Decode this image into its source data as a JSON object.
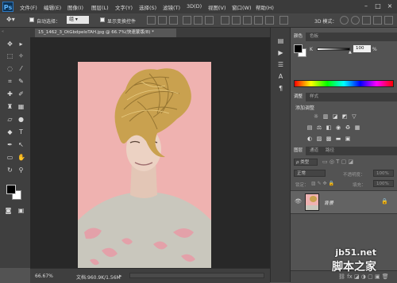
{
  "app": {
    "logo": "Ps"
  },
  "menu": [
    "文件(F)",
    "编辑(E)",
    "图像(I)",
    "图层(L)",
    "文字(Y)",
    "选择(S)",
    "滤镜(T)",
    "3D(D)",
    "视图(V)",
    "窗口(W)",
    "帮助(H)"
  ],
  "window_controls": {
    "minimize": "–",
    "maximize": "□",
    "close": "×"
  },
  "options_bar": {
    "auto_select_label": "自动选择：",
    "auto_select_value": "组",
    "show_transform_label": "显示变换控件",
    "mode_label": "3D 模式："
  },
  "document": {
    "tab_title": "15_1462_3_OtGbdpeloTAH.jpg @ 66.7%(快速蒙版/8) *"
  },
  "status": {
    "zoom": "66.67%",
    "doc_info": "文档:960.9K/1.56M"
  },
  "color_panel": {
    "tabs": [
      "颜色",
      "色板"
    ],
    "channel_label": "K",
    "value": "100",
    "unit": "%",
    "fg_color": "#000000",
    "bg_color": "#ffffff"
  },
  "adjust_panel": {
    "tabs": [
      "调整",
      "样式"
    ],
    "heading": "添加调整"
  },
  "layers_panel": {
    "tabs": [
      "图层",
      "通道",
      "路径"
    ],
    "filter_label": "ρ 类型",
    "blend_mode": "正常",
    "opacity_label": "不透明度：",
    "opacity_value": "100%",
    "lock_label": "锁定：",
    "fill_label": "填充：",
    "fill_value": "100%",
    "layer_name": "背景"
  },
  "watermark": {
    "site": "jb51.net",
    "brand": "脚本之家"
  }
}
